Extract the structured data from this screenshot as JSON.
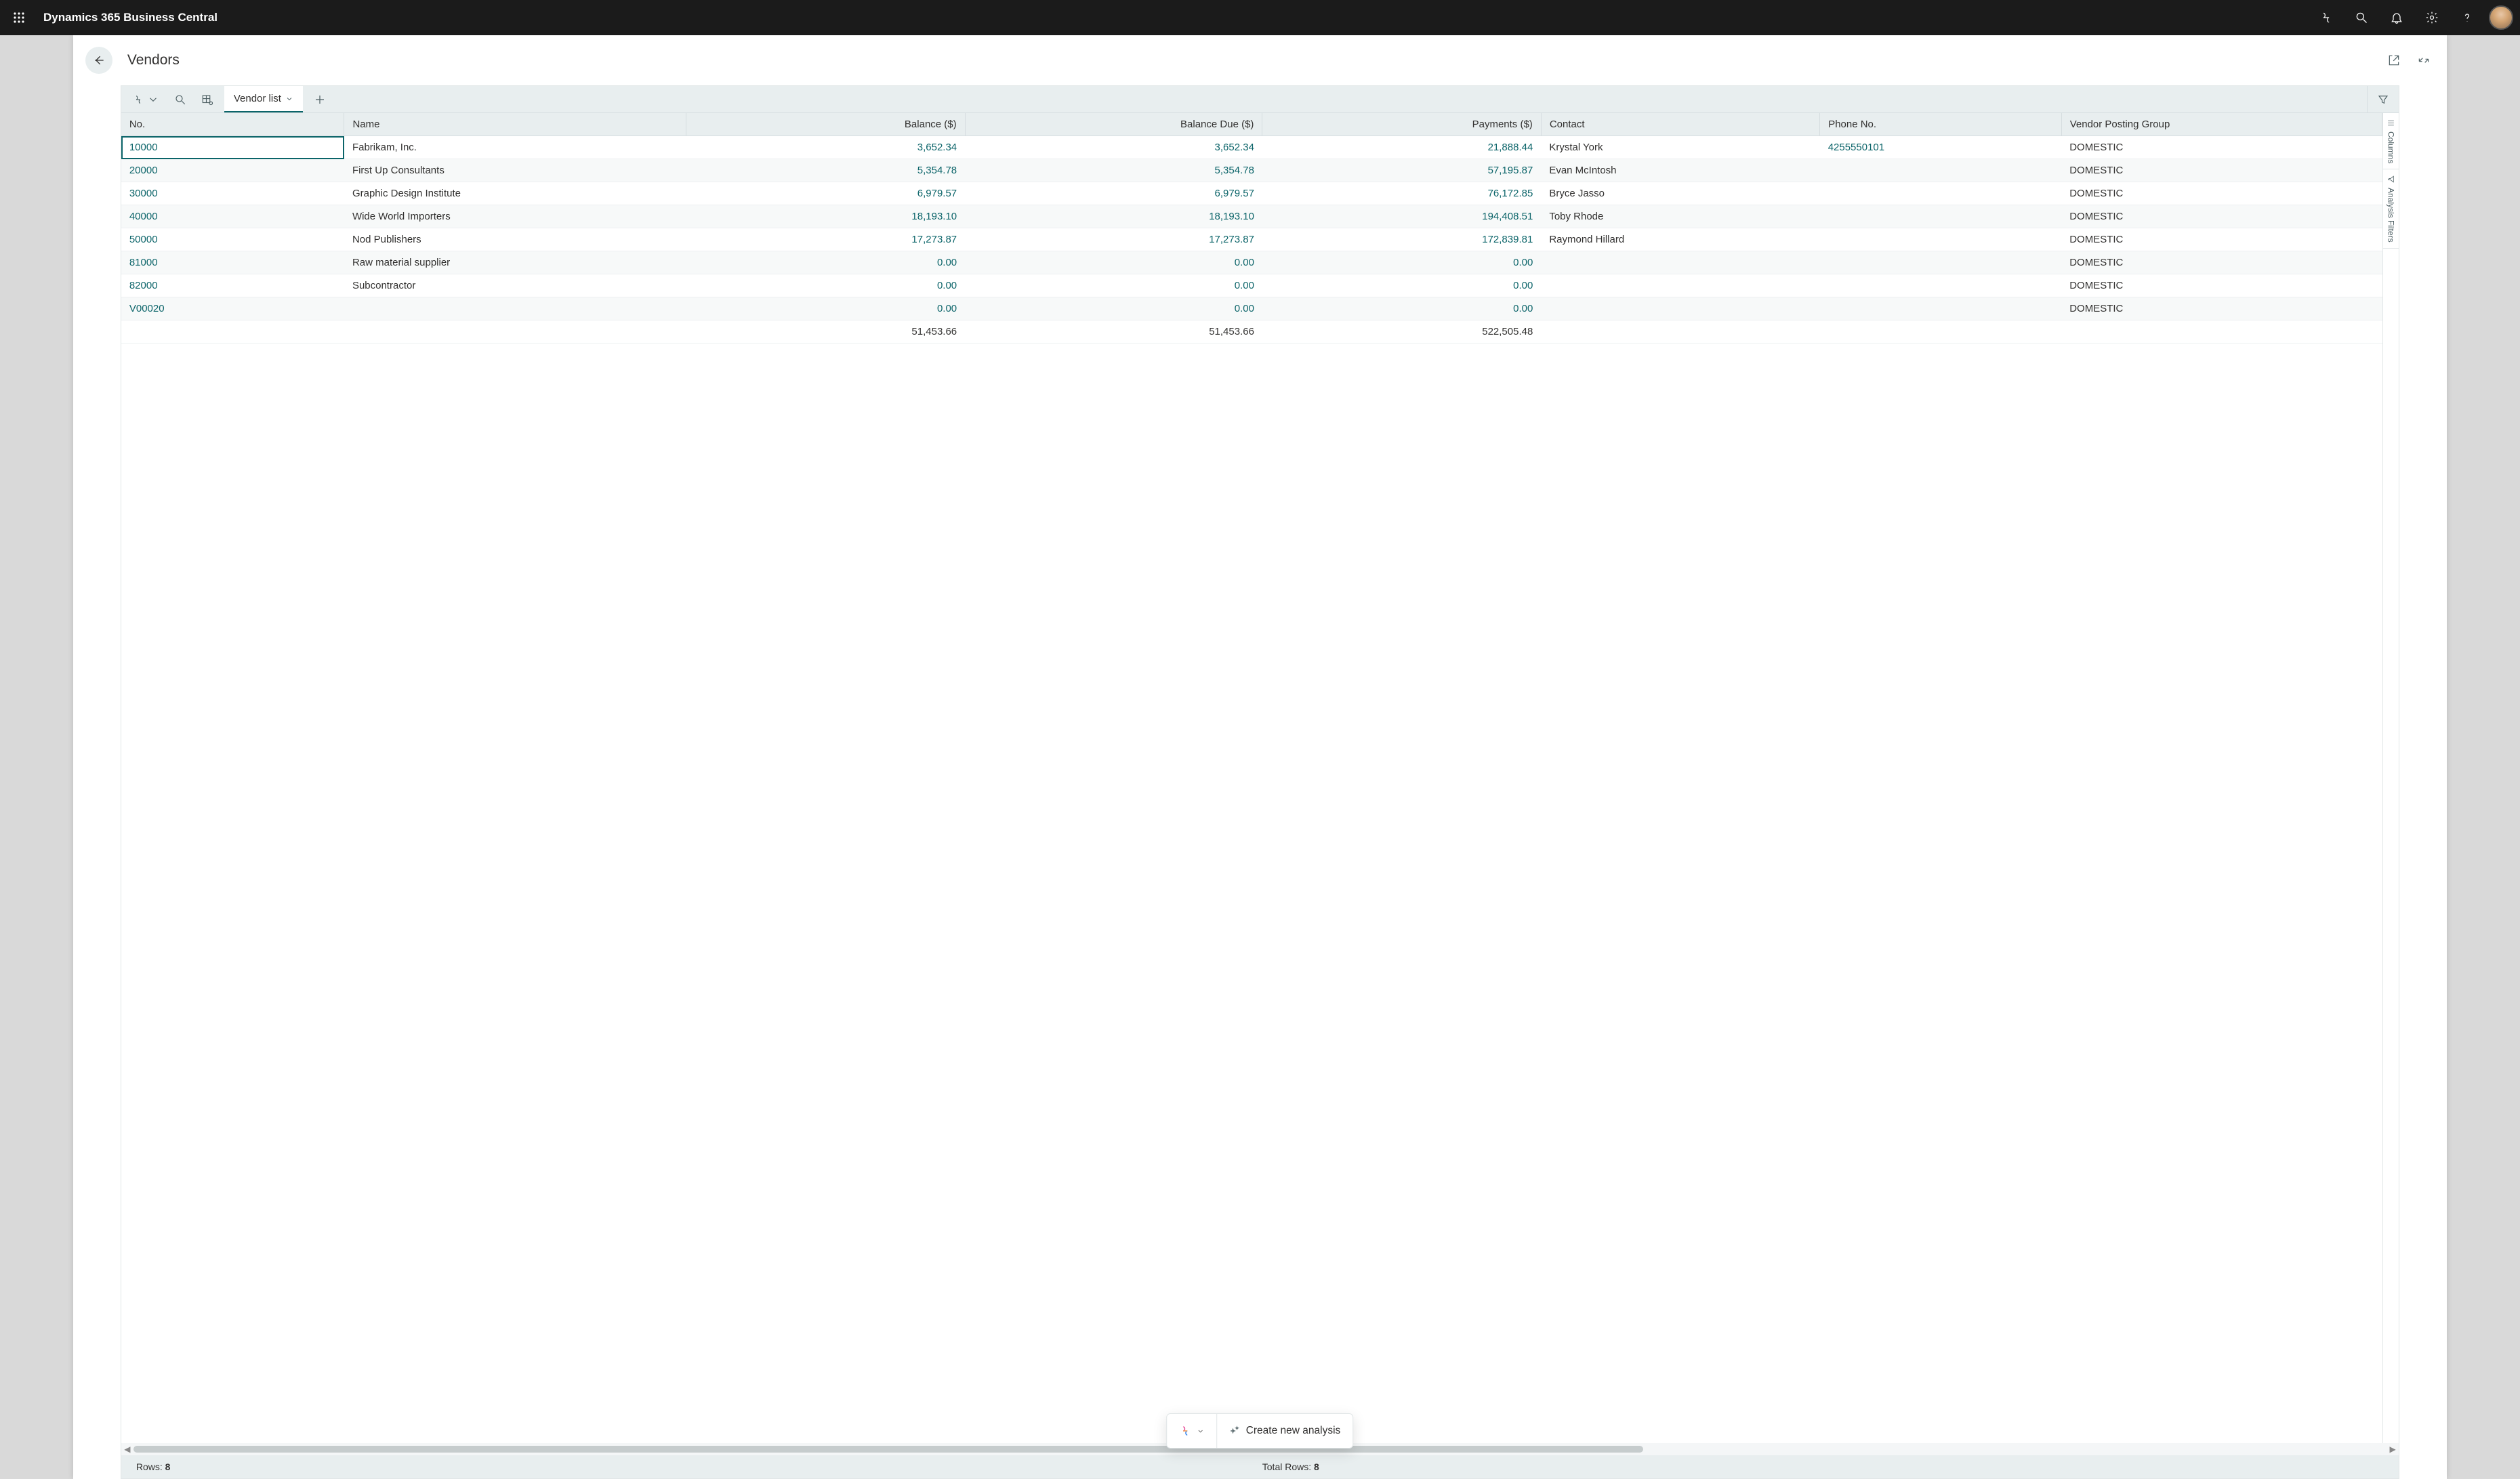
{
  "app": {
    "title": "Dynamics 365 Business Central"
  },
  "page": {
    "title": "Vendors"
  },
  "toolbar": {
    "tab_label": "Vendor list"
  },
  "columns": {
    "no": "No.",
    "name": "Name",
    "balance": "Balance ($)",
    "balance_due": "Balance Due ($)",
    "payments": "Payments ($)",
    "contact": "Contact",
    "phone": "Phone No.",
    "vpg": "Vendor Posting Group"
  },
  "rows": [
    {
      "no": "10000",
      "name": "Fabrikam, Inc.",
      "balance": "3,652.34",
      "due": "3,652.34",
      "payments": "21,888.44",
      "contact": "Krystal York",
      "phone": "4255550101",
      "vpg": "DOMESTIC"
    },
    {
      "no": "20000",
      "name": "First Up Consultants",
      "balance": "5,354.78",
      "due": "5,354.78",
      "payments": "57,195.87",
      "contact": "Evan McIntosh",
      "phone": "",
      "vpg": "DOMESTIC"
    },
    {
      "no": "30000",
      "name": "Graphic Design Institute",
      "balance": "6,979.57",
      "due": "6,979.57",
      "payments": "76,172.85",
      "contact": "Bryce Jasso",
      "phone": "",
      "vpg": "DOMESTIC"
    },
    {
      "no": "40000",
      "name": "Wide World Importers",
      "balance": "18,193.10",
      "due": "18,193.10",
      "payments": "194,408.51",
      "contact": "Toby Rhode",
      "phone": "",
      "vpg": "DOMESTIC"
    },
    {
      "no": "50000",
      "name": "Nod Publishers",
      "balance": "17,273.87",
      "due": "17,273.87",
      "payments": "172,839.81",
      "contact": "Raymond Hillard",
      "phone": "",
      "vpg": "DOMESTIC"
    },
    {
      "no": "81000",
      "name": "Raw material supplier",
      "balance": "0.00",
      "due": "0.00",
      "payments": "0.00",
      "contact": "",
      "phone": "",
      "vpg": "DOMESTIC"
    },
    {
      "no": "82000",
      "name": "Subcontractor",
      "balance": "0.00",
      "due": "0.00",
      "payments": "0.00",
      "contact": "",
      "phone": "",
      "vpg": "DOMESTIC"
    },
    {
      "no": "V00020",
      "name": "",
      "balance": "0.00",
      "due": "0.00",
      "payments": "0.00",
      "contact": "",
      "phone": "",
      "vpg": "DOMESTIC"
    }
  ],
  "totals": {
    "balance": "51,453.66",
    "due": "51,453.66",
    "payments": "522,505.48"
  },
  "rail": {
    "columns": "Columns",
    "filters": "Analysis Filters"
  },
  "status": {
    "rows_label": "Rows:",
    "rows_value": "8",
    "total_rows_label": "Total Rows:",
    "total_rows_value": "8"
  },
  "pill": {
    "action": "Create new analysis"
  }
}
